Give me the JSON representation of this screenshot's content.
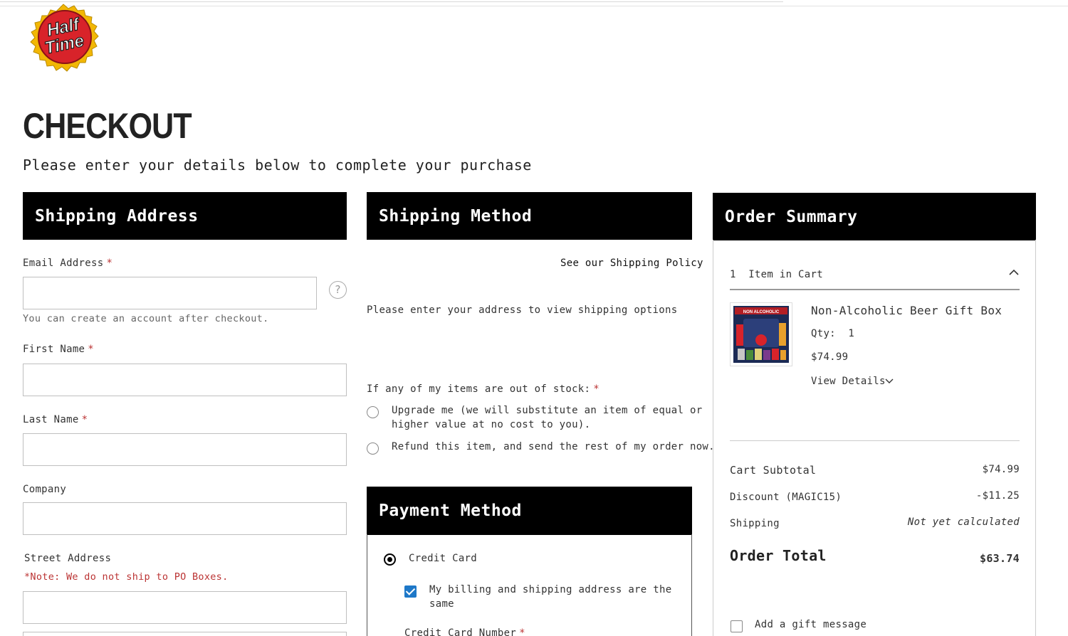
{
  "logo": {
    "text_line1": "Half",
    "text_line2": "Time",
    "colors": {
      "cap": "#d8232a",
      "rim": "#f2b705"
    }
  },
  "page": {
    "title": "CHECKOUT",
    "subtitle": "Please enter your details below to complete your purchase"
  },
  "shipping_address": {
    "heading": "Shipping Address",
    "email_label": "Email Address",
    "email_value": "",
    "email_hint": "You can create an account after checkout.",
    "first_name_label": "First Name",
    "first_name_value": "",
    "last_name_label": "Last Name",
    "last_name_value": "",
    "company_label": "Company",
    "company_value": "",
    "street_label": "Street Address",
    "street_note": "*Note: We do not ship to PO Boxes.",
    "street_value": "",
    "required_mark": "*"
  },
  "shipping_method": {
    "heading": "Shipping Method",
    "policy_link": "See our Shipping Policy",
    "placeholder_text": "Please enter your address to view shipping options",
    "out_of_stock_label": "If any of my items are out of stock:",
    "options": [
      {
        "label_line1": "Upgrade me (we will substitute an item of equal or",
        "label_line2": "higher value at no cost to you).",
        "selected": false
      },
      {
        "label_line1": "Refund this item, and send the rest of my order now.",
        "selected": false
      }
    ]
  },
  "payment_method": {
    "heading": "Payment Method",
    "credit_card_label": "Credit Card",
    "credit_card_selected": true,
    "billing_same_line1": "My billing and shipping address are the",
    "billing_same_line2": "same",
    "billing_same_checked": true,
    "card_number_label": "Credit Card Number"
  },
  "order_summary": {
    "heading": "Order Summary",
    "items_count": "1",
    "items_label": "Item in Cart",
    "product": {
      "name": "Non-Alcoholic Beer Gift Box",
      "qty_label": "Qty:",
      "qty": "1",
      "price": "$74.99",
      "view_details": "View Details",
      "image_label": "NON ALCOHOLIC"
    },
    "cart_subtotal_label": "Cart Subtotal",
    "cart_subtotal": "$74.99",
    "discount_label": "Discount (MAGIC15)",
    "discount": "-$11.25",
    "shipping_label": "Shipping",
    "shipping_value": "Not yet calculated",
    "order_total_label": "Order Total",
    "order_total": "$63.74",
    "gift_message_label": "Add a gift message",
    "gift_message_checked": false
  },
  "icons": {
    "help": "question-circle-icon",
    "collapse": "chevron-up-icon",
    "expand": "chevron-down-icon"
  },
  "colors": {
    "header_bg": "#000000",
    "required": "#bb3333",
    "checkbox_accent": "#1e78c8"
  }
}
